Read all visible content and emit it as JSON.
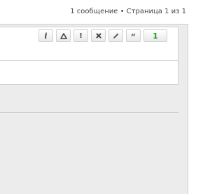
{
  "pagination": {
    "text": "1 сообщение • Страница 1 из 1"
  },
  "toolbar": {
    "info_label": "i",
    "report_label": "!",
    "quote_label": "“",
    "count_label": "1"
  },
  "colors": {
    "count": "#1e9a1e",
    "panel_background": "#ececec",
    "border": "#cfcfcf"
  },
  "icons": [
    "info-icon",
    "warning-icon",
    "report-icon",
    "delete-icon",
    "edit-icon",
    "quote-icon"
  ]
}
